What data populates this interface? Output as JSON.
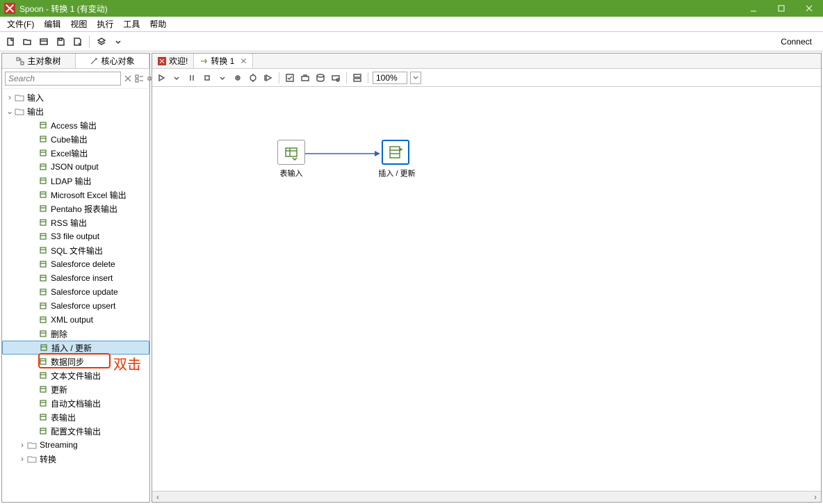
{
  "window": {
    "title": "Spoon - 转换 1 (有变动)"
  },
  "menu": {
    "file": "文件(F)",
    "edit": "编辑",
    "view": "视图",
    "run": "执行",
    "tools": "工具",
    "help": "帮助"
  },
  "toolbar": {
    "connect": "Connect"
  },
  "sidebar": {
    "tabs": {
      "tree": "主对象树",
      "core": "核心对象"
    },
    "search_placeholder": "Search",
    "input_cat": "输入",
    "output_cat": "输出",
    "output_items": [
      "Access 输出",
      "Cube输出",
      "Excel输出",
      "JSON output",
      "LDAP 输出",
      "Microsoft Excel 输出",
      "Pentaho 报表输出",
      "RSS 输出",
      "S3 file output",
      "SQL 文件输出",
      "Salesforce delete",
      "Salesforce insert",
      "Salesforce update",
      "Salesforce upsert",
      "XML output",
      "删除",
      "插入 / 更新",
      "数据同步",
      "文本文件输出",
      "更新",
      "自动文档输出",
      "表输出",
      "配置文件输出"
    ],
    "streaming": "Streaming",
    "transform": "转换"
  },
  "editor": {
    "tabs": [
      {
        "label": "欢迎!",
        "active": false
      },
      {
        "label": "转换 1",
        "active": true
      }
    ],
    "zoom": "100%"
  },
  "canvas": {
    "step1": "表输入",
    "step2": "插入 / 更新"
  },
  "annotation": {
    "dbl_click": "双击"
  }
}
